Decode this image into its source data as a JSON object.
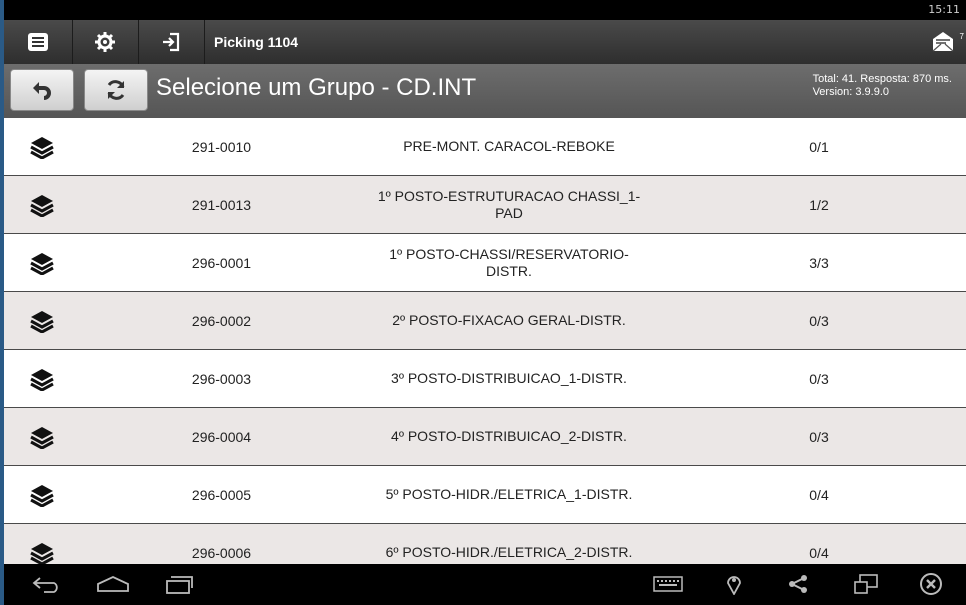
{
  "status": {
    "time": "15:11"
  },
  "actionbar": {
    "title": "Picking 1104",
    "icons": [
      "menu-icon",
      "settings-icon",
      "login-icon",
      "mail-icon"
    ],
    "mail_badge": "7"
  },
  "header": {
    "title": "Selecione um Grupo - CD.INT",
    "info_line1": "Total: 41. Resposta: 870 ms.",
    "info_line2": "Version: 3.9.9.0",
    "back_icon": "undo-icon",
    "refresh_icon": "refresh-icon"
  },
  "rows": [
    {
      "code": "291-0010",
      "desc": "PRE-MONT. CARACOL-REBOKE",
      "qty": "0/1"
    },
    {
      "code": "291-0013",
      "desc": "1º POSTO-ESTRUTURACAO CHASSI_1-\nPAD",
      "qty": "1/2"
    },
    {
      "code": "296-0001",
      "desc": "1º POSTO-CHASSI/RESERVATORIO-\nDISTR.",
      "qty": "3/3"
    },
    {
      "code": "296-0002",
      "desc": "2º POSTO-FIXACAO GERAL-DISTR.",
      "qty": "0/3"
    },
    {
      "code": "296-0003",
      "desc": "3º POSTO-DISTRIBUICAO_1-DISTR.",
      "qty": "0/3"
    },
    {
      "code": "296-0004",
      "desc": "4º POSTO-DISTRIBUICAO_2-DISTR.",
      "qty": "0/3"
    },
    {
      "code": "296-0005",
      "desc": "5º POSTO-HIDR./ELETRICA_1-DISTR.",
      "qty": "0/4"
    },
    {
      "code": "296-0006",
      "desc": "6º POSTO-HIDR./ELETRICA_2-DISTR.",
      "qty": "0/4"
    }
  ],
  "navbar": {
    "icons": [
      "back-icon",
      "home-icon",
      "recent-apps-icon",
      "keyboard-icon",
      "location-icon",
      "share-icon",
      "screen-icon",
      "close-icon"
    ]
  }
}
